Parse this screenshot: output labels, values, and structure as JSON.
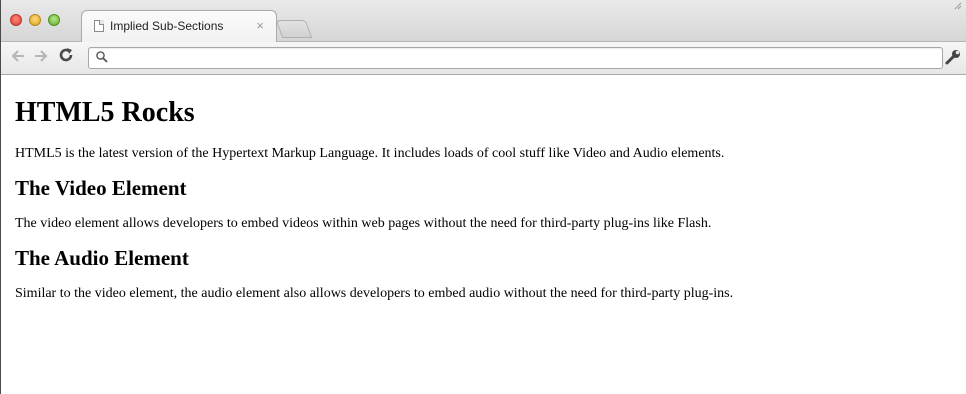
{
  "browser": {
    "tab": {
      "title": "Implied Sub-Sections",
      "close_glyph": "×",
      "favicon": "page-icon"
    },
    "toolbar": {
      "back_icon": "back-arrow-icon",
      "forward_icon": "forward-arrow-icon",
      "reload_icon": "reload-icon",
      "address_value": "",
      "address_placeholder": "",
      "menu_icon": "wrench-icon"
    },
    "traffic_lights": {
      "close_color": "#d8392a",
      "minimize_color": "#dca21b",
      "maximize_color": "#5fae2d"
    }
  },
  "page": {
    "heading": "HTML5 Rocks",
    "intro": "HTML5 is the latest version of the Hypertext Markup Language. It includes loads of cool stuff like Video and Audio elements.",
    "sections": [
      {
        "heading": "The Video Element",
        "body": "The video element allows developers to embed videos within web pages without the need for third-party plug-ins like Flash."
      },
      {
        "heading": "The Audio Element",
        "body": "Similar to the video element, the audio element also allows developers to embed audio without the need for third-party plug-ins."
      }
    ]
  }
}
